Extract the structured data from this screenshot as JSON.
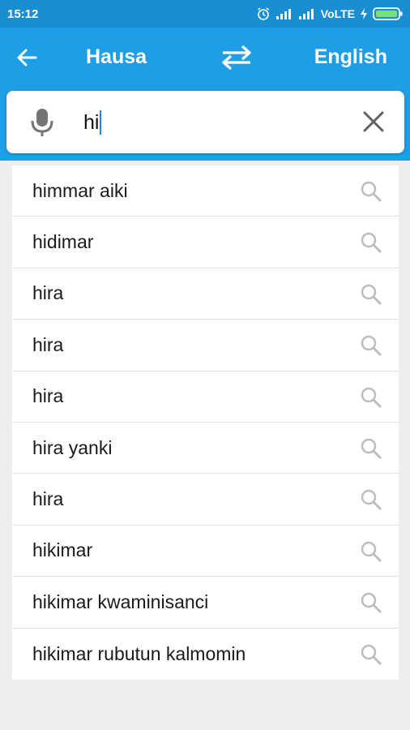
{
  "status_bar": {
    "time": "15:12",
    "network": "VoLTE"
  },
  "app_bar": {
    "source_language": "Hausa",
    "target_language": "English"
  },
  "search": {
    "value": "hi"
  },
  "suggestions": [
    {
      "text": "himmar aiki"
    },
    {
      "text": "hidimar"
    },
    {
      "text": "hira"
    },
    {
      "text": "hira"
    },
    {
      "text": "hira"
    },
    {
      "text": "hira yanki"
    },
    {
      "text": "hira"
    },
    {
      "text": "hikimar"
    },
    {
      "text": "hikimar kwaminisanci"
    },
    {
      "text": "hikimar rubutun kalmomin"
    }
  ],
  "colors": {
    "primary": "#1e9ee6",
    "status_bar": "#1a8ed3",
    "background": "#eeeeee"
  }
}
